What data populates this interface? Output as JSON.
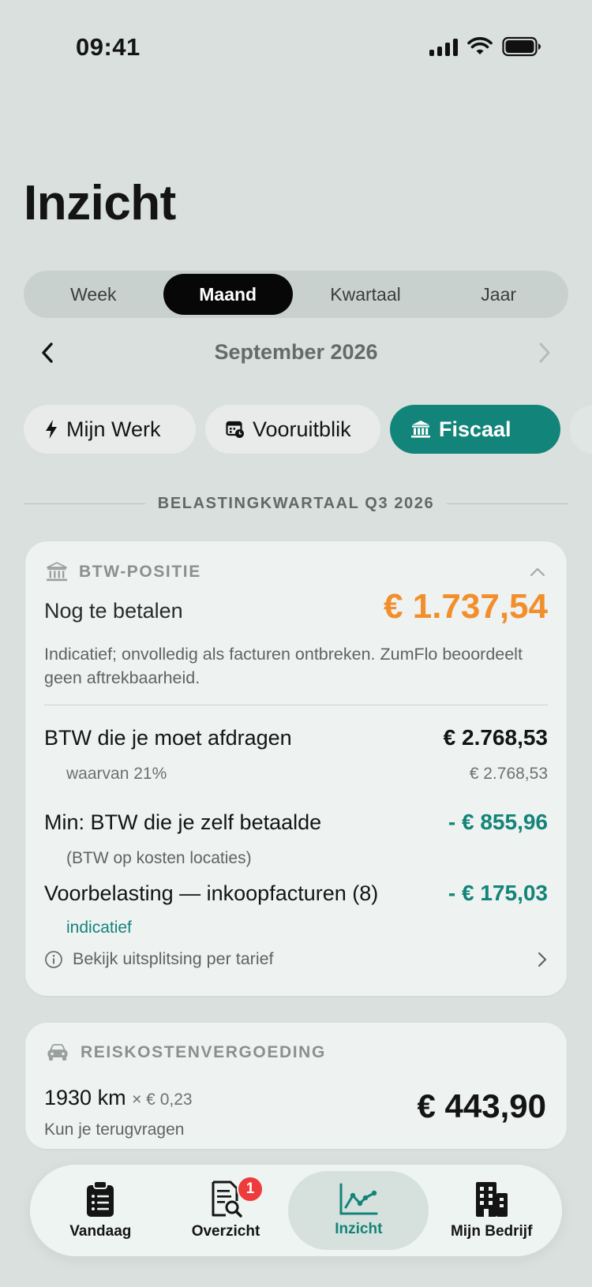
{
  "status_bar": {
    "time": "09:41"
  },
  "header": {
    "title": "Inzicht"
  },
  "period_tabs": [
    {
      "label": "Week"
    },
    {
      "label": "Maand"
    },
    {
      "label": "Kwartaal"
    },
    {
      "label": "Jaar"
    }
  ],
  "period_selected": "Maand",
  "month_nav": {
    "label": "September 2026"
  },
  "chips": [
    {
      "label": "Mijn Werk",
      "icon": "bolt-icon"
    },
    {
      "label": "Vooruitblik",
      "icon": "calendar-clock-icon"
    },
    {
      "label": "Fiscaal",
      "icon": "bank-icon"
    }
  ],
  "chip_selected": "Fiscaal",
  "section": {
    "title": "BELASTINGKWARTAAL Q3 2026"
  },
  "btw_card": {
    "title": "BTW-POSITIE",
    "pay_label": "Nog te betalen",
    "pay_amount": "€ 1.737,54",
    "note": "Indicatief; onvolledig als facturen ontbreken. ZumFlo beoordeelt geen aftrekbaarheid.",
    "rows": [
      {
        "label": "BTW die je moet afdragen",
        "amount": "€ 2.768,53"
      },
      {
        "label": "waarvan 21%",
        "amount": "€ 2.768,53"
      },
      {
        "label": "Min: BTW die je zelf betaalde",
        "amount": "- € 855,96"
      },
      {
        "label": "(BTW op kosten locaties)"
      },
      {
        "label": "Voorbelasting — inkoopfacturen (8)",
        "amount": "- € 175,03"
      },
      {
        "label": "indicatief"
      }
    ],
    "link": "Bekijk uitsplitsing per tarief",
    "colors": {
      "due": "#f28f2c",
      "deduction": "#138478"
    }
  },
  "reis_card": {
    "title": "REISKOSTENVERGOEDING",
    "km": "1930 km",
    "rate": "× € 0,23",
    "sub": "Kun je terugvragen",
    "amount": "€ 443,90"
  },
  "tabbar": [
    {
      "label": "Vandaag",
      "icon": "clipboard-list-icon"
    },
    {
      "label": "Overzicht",
      "icon": "document-search-icon",
      "badge": "1"
    },
    {
      "label": "Inzicht",
      "icon": "line-chart-icon"
    },
    {
      "label": "Mijn Bedrijf",
      "icon": "building-icon"
    }
  ],
  "tab_selected": "Inzicht",
  "accent_color": "#12847a"
}
